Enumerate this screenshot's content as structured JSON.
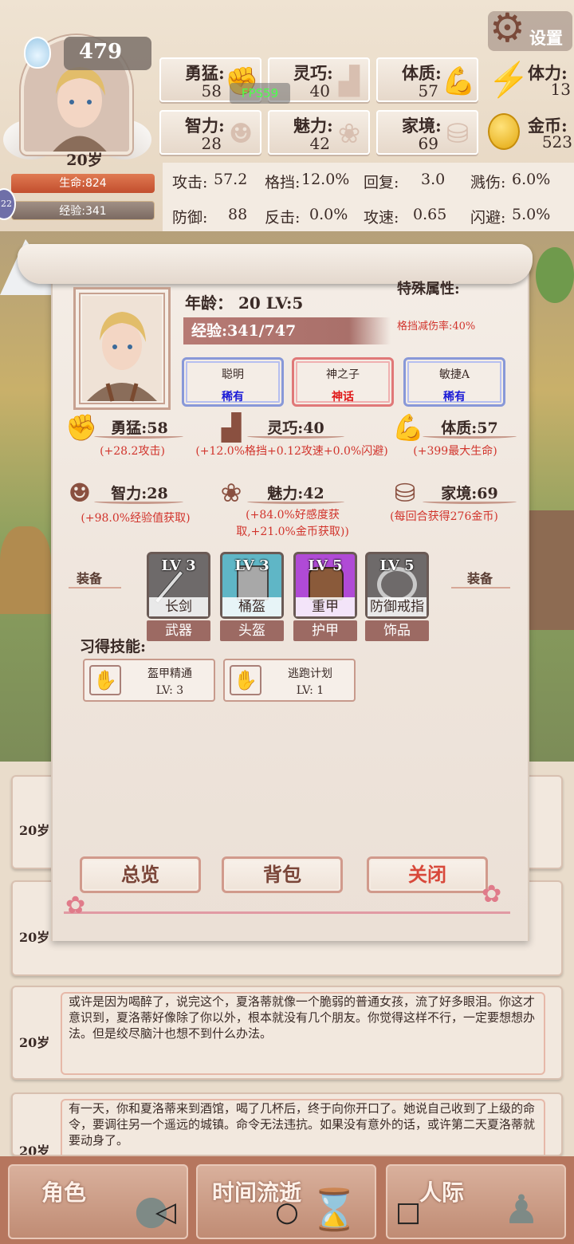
{
  "hud": {
    "soul_count": "479",
    "age": "20岁",
    "hp": "生命:824",
    "exp": "经验:341",
    "level_chip": "22",
    "fps": "FPS59",
    "settings": "设置",
    "stats": [
      {
        "label": "勇猛:",
        "value": "58",
        "icon": "fist-icon"
      },
      {
        "label": "灵巧:",
        "value": "40",
        "icon": "cloak-icon"
      },
      {
        "label": "体质:",
        "value": "57",
        "icon": "arm-icon"
      },
      {
        "label": "智力:",
        "value": "28",
        "icon": "brain-icon"
      },
      {
        "label": "魅力:",
        "value": "42",
        "icon": "flower-icon"
      },
      {
        "label": "家境:",
        "value": "69",
        "icon": "coin-stack-icon"
      }
    ],
    "stamina": {
      "label": "体力:",
      "value": "13"
    },
    "gold": {
      "label": "金币:",
      "value": "523"
    },
    "combat": [
      {
        "label": "攻击:",
        "value": "57.2"
      },
      {
        "label": "格挡:",
        "value": "12.0%"
      },
      {
        "label": "回复:",
        "value": "3.0"
      },
      {
        "label": "溅伤:",
        "value": "6.0%"
      },
      {
        "label": "防御:",
        "value": "88"
      },
      {
        "label": "反击:",
        "value": "0.0%"
      },
      {
        "label": "攻速:",
        "value": "0.65"
      },
      {
        "label": "闪避:",
        "value": "5.0%"
      }
    ]
  },
  "modal": {
    "age_level": "年龄： 20    LV:5",
    "exp": "经验:341/747",
    "special_title": "特殊属性:",
    "special_value": "格挡减伤率:40%",
    "traits": [
      {
        "name": "聪明",
        "rarity": "稀有",
        "color": "#1a1ad6"
      },
      {
        "name": "神之子",
        "rarity": "神话",
        "color": "#e01818"
      },
      {
        "name": "敏捷A",
        "rarity": "稀有",
        "color": "#1a1ad6"
      }
    ],
    "attributes": [
      {
        "label": "勇猛:58",
        "bonus": "(+28.2攻击)"
      },
      {
        "label": "灵巧:40",
        "bonus": "(+12.0%格挡+0.12攻速+0.0%闪避)"
      },
      {
        "label": "体质:57",
        "bonus": "(+399最大生命)"
      },
      {
        "label": "智力:28",
        "bonus": "(+98.0%经验值获取)"
      },
      {
        "label": "魅力:42",
        "bonus": "(+84.0%好感度获取,+21.0%金币获取))"
      },
      {
        "label": "家境:69",
        "bonus": "(每回合获得276金币)"
      }
    ],
    "equip_label": "装备",
    "equipment": [
      {
        "level": "LV 3",
        "name": "长剑",
        "type": "武器",
        "bg": "#777070"
      },
      {
        "level": "LV 3",
        "name": "桶盔",
        "type": "头盔",
        "bg": "#5fb6c6"
      },
      {
        "level": "LV 5",
        "name": "重甲",
        "type": "护甲",
        "bg": "#b04ad6"
      },
      {
        "level": "LV 5",
        "name": "防御戒指",
        "type": "饰品",
        "bg": "#6e6a6a"
      }
    ],
    "skills_title": "习得技能:",
    "skills": [
      {
        "name": "盔甲精通",
        "level": "LV: 3"
      },
      {
        "name": "逃跑计划",
        "level": "LV: 1"
      }
    ],
    "buttons": {
      "overview": "总览",
      "bag": "背包",
      "close": "关闭"
    }
  },
  "log": [
    {
      "age": "20岁",
      "text": ""
    },
    {
      "age": "20岁",
      "text": ""
    },
    {
      "age": "20岁",
      "text": "或许是因为喝醉了，说完这个，夏洛蒂就像一个脆弱的普通女孩，流了好多眼泪。你这才意识到，夏洛蒂好像除了你以外，根本就没有几个朋友。你觉得这样不行，一定要想想办法。但是绞尽脑汁也想不到什么办法。"
    },
    {
      "age": "20岁",
      "text": "有一天，你和夏洛蒂来到酒馆，喝了几杯后，终于向你开口了。她说自己收到了上级的命令，要调往另一个遥远的城镇。命令无法违抗。如果没有意外的话，或许第二天夏洛蒂就要动身了。"
    }
  ],
  "nav": {
    "tabs": [
      "角色",
      "时间流逝",
      "人际"
    ]
  }
}
